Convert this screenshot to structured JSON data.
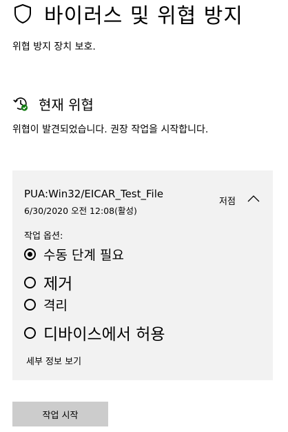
{
  "header": {
    "title": "바이러스 및 위협 방지",
    "subtitle": "위협 방지 장치 보호.",
    "icon": "shield-icon"
  },
  "current_threats": {
    "title": "현재 위협",
    "icon": "history-check-icon",
    "description": "위협이 발견되었습니다. 권장 작업을 시작합니다.",
    "threat": {
      "name": "PUA:Win32/EICAR_Test_File",
      "date": "6/30/2020 오전 12:08(활성)",
      "severity": "저점",
      "expanded": true,
      "options_label": "작업 옵션:",
      "options": [
        {
          "label": "수동 단계 필요",
          "selected": true
        },
        {
          "label": "제거",
          "selected": false
        },
        {
          "label": "격리",
          "selected": false
        },
        {
          "label": "디바이스에서 허용",
          "selected": false
        }
      ],
      "details_link": "세부 정보 보기"
    },
    "start_button": "작업 시작"
  },
  "colors": {
    "card_background": "#f2f2f2",
    "button_background": "#cccccc",
    "status_green": "#107c10"
  }
}
